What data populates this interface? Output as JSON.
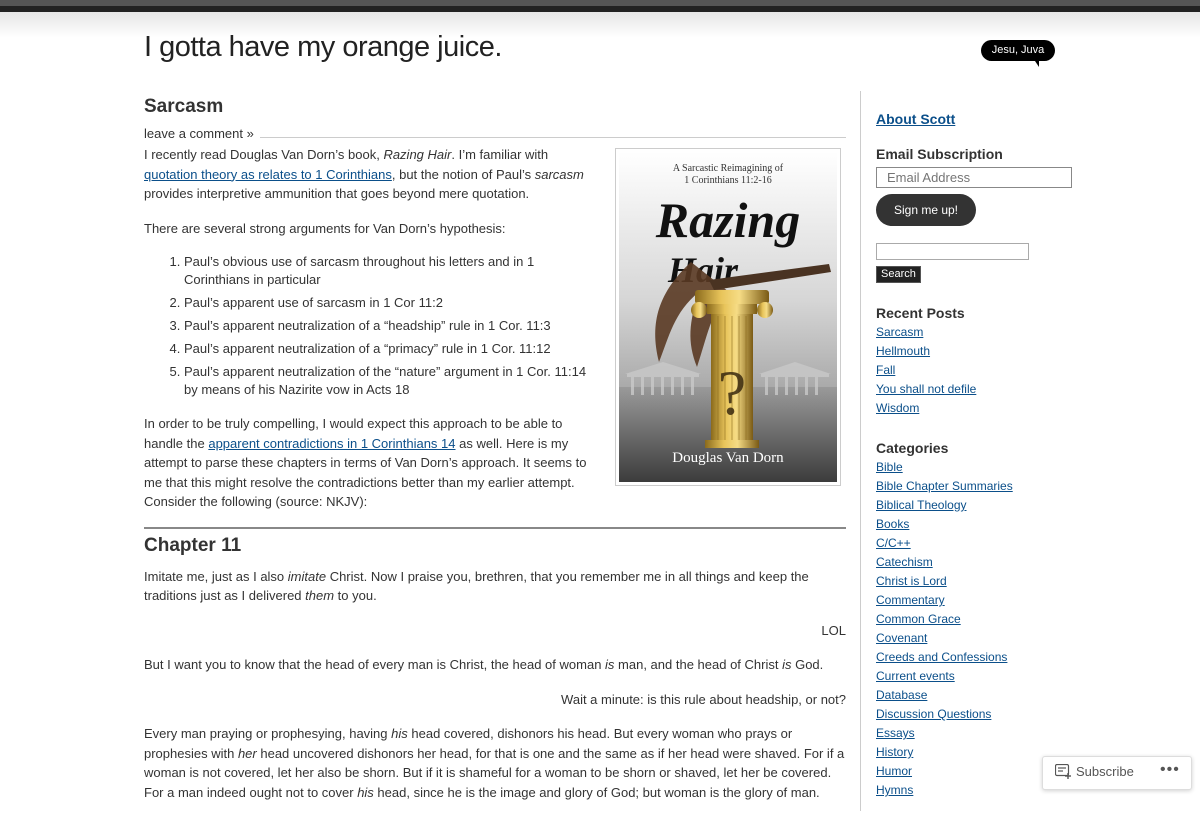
{
  "site": {
    "title": "I gotta have my orange juice.",
    "tagline": "Jesu, Juva"
  },
  "post": {
    "title": "Sarcasm",
    "meta_link": "leave a comment »",
    "intro": {
      "t1": "I recently read Douglas Van Dorn’s book, ",
      "book_title": "Razing Hair",
      "t2": ". I’m familiar with ",
      "link1": "quotation theory as relates to 1 Corinthians",
      "t3": ", but the notion of Paul’s ",
      "sarcasm": "sarcasm",
      "t4": " provides interpretive ammunition that goes beyond mere quotation."
    },
    "arguments_intro": "There are several strong arguments for Van Dorn’s hypothesis:",
    "arguments": [
      "Paul’s obvious use of sarcasm throughout his letters and in 1 Corinthians in particular",
      "Paul’s apparent use of sarcasm in 1 Cor 11:2",
      "Paul’s apparent neutralization of a “headship” rule in 1 Cor. 11:3",
      "Paul’s apparent neutralization of a “primacy” rule in 1 Cor. 11:12",
      "Paul’s apparent neutralization of the “nature” argument in 1 Cor. 11:14 by means of his Nazirite vow in Acts 18"
    ],
    "compelling": {
      "t1": "In order to be truly compelling, I would expect this approach to be able to handle the ",
      "link": "apparent contradictions in 1 Corinthians 14",
      "t2": " as well. Here is my attempt to parse these chapters in terms of Van Dorn’s approach. It seems to me that this might resolve the contradictions better than my earlier attempt. Consider the following (source: NKJV):"
    },
    "chapter_heading": "Chapter 11",
    "v1": {
      "t1": "Imitate me, just as I also ",
      "em1": "imitate",
      "t2": " Christ. Now I praise you, brethren, that you remember me in all things and keep the traditions just as I delivered ",
      "em2": "them",
      "t3": " to you."
    },
    "comment1": "LOL",
    "v2": {
      "t1": "But I want you to know that the head of every man is Christ, the head of woman ",
      "em1": "is",
      "t2": " man, and the head of Christ ",
      "em2": "is",
      "t3": " God."
    },
    "comment2": "Wait a minute: is this rule about headship, or not?",
    "v3": {
      "t1": "Every man praying or prophesying, having ",
      "em1": "his",
      "t2": " head covered, dishonors his head. But every woman who prays or prophesies with ",
      "em2": "her",
      "t3": " head uncovered dishonors her head, for that is one and the same as if her head were shaved. For if a woman is not covered, let her also be shorn. But if it is shameful for a woman to be shorn or shaved, let her be covered. For a man indeed ought not to cover ",
      "em3": "his",
      "t4": " head, since he is the image and glory of God; but woman is the glory of man."
    }
  },
  "book_cover": {
    "subtitle_line1": "A Sarcastic Reimagining of",
    "subtitle_line2": "1 Corinthians 11:2-16",
    "title_line1": "Razing",
    "title_line2": "Hair",
    "question_mark": "?",
    "author": "Douglas Van Dorn"
  },
  "sidebar": {
    "about_link": "About Scott",
    "email_title": "Email Subscription",
    "email_placeholder": "Email Address",
    "signup_label": "Sign me up!",
    "search_label": "Search",
    "recent_title": "Recent Posts",
    "recent_posts": [
      "Sarcasm",
      "Hellmouth",
      "Fall",
      "You shall not defile",
      "Wisdom"
    ],
    "categories_title": "Categories",
    "categories": [
      "Bible",
      "Bible Chapter Summaries",
      "Biblical Theology",
      "Books",
      "C/C++",
      "Catechism",
      "Christ is Lord",
      "Commentary",
      "Common Grace",
      "Covenant",
      "Creeds and Confessions",
      "Current events",
      "Database",
      "Discussion Questions",
      "Essays",
      "History",
      "Humor",
      "Hymns"
    ]
  },
  "subscribe_bar": {
    "subscribe_label": "Subscribe",
    "more_label": "•••"
  },
  "colors": {
    "link": "#0b4f8a",
    "text": "#333333",
    "bubble": "#000000"
  }
}
